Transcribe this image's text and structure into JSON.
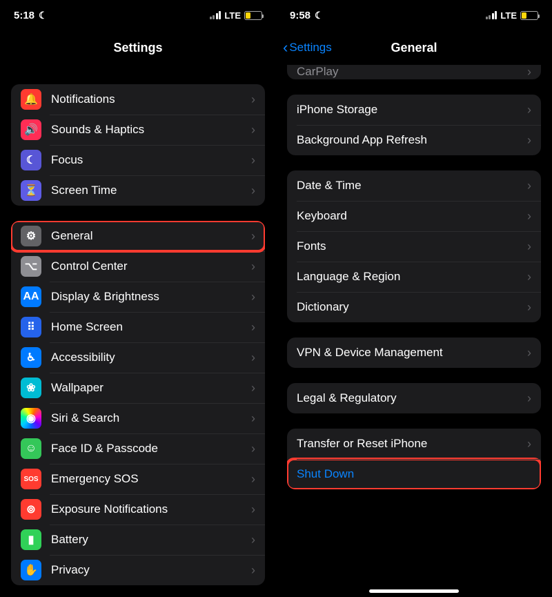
{
  "left": {
    "status": {
      "time": "5:18",
      "network_label": "LTE"
    },
    "title": "Settings",
    "groups": [
      {
        "rows": [
          {
            "id": "notifications",
            "label": "Notifications",
            "icon": "bell-icon",
            "icon_bg": "ic-red",
            "glyph": "🔔"
          },
          {
            "id": "sounds",
            "label": "Sounds & Haptics",
            "icon": "speaker-icon",
            "icon_bg": "ic-pink",
            "glyph": "🔊"
          },
          {
            "id": "focus",
            "label": "Focus",
            "icon": "moon-icon",
            "icon_bg": "ic-indigo",
            "glyph": "☾"
          },
          {
            "id": "screentime",
            "label": "Screen Time",
            "icon": "hourglass-icon",
            "icon_bg": "ic-violet",
            "glyph": "⏳"
          }
        ]
      },
      {
        "rows": [
          {
            "id": "general",
            "label": "General",
            "icon": "gear-icon",
            "icon_bg": "ic-gray",
            "glyph": "⚙",
            "highlight": true
          },
          {
            "id": "controlcenter",
            "label": "Control Center",
            "icon": "switches-icon",
            "icon_bg": "ic-graylight",
            "glyph": "⌥"
          },
          {
            "id": "display",
            "label": "Display & Brightness",
            "icon": "text-size-icon",
            "icon_bg": "ic-blue",
            "glyph": "AA"
          },
          {
            "id": "homescreen",
            "label": "Home Screen",
            "icon": "grid-icon",
            "icon_bg": "ic-homescreen",
            "glyph": "⠿"
          },
          {
            "id": "accessibility",
            "label": "Accessibility",
            "icon": "accessibility-icon",
            "icon_bg": "ic-blue",
            "glyph": "♿︎"
          },
          {
            "id": "wallpaper",
            "label": "Wallpaper",
            "icon": "flower-icon",
            "icon_bg": "ic-teal",
            "glyph": "❀"
          },
          {
            "id": "siri",
            "label": "Siri & Search",
            "icon": "siri-icon",
            "icon_bg": "ic-siri",
            "glyph": "◉"
          },
          {
            "id": "faceid",
            "label": "Face ID & Passcode",
            "icon": "faceid-icon",
            "icon_bg": "ic-green",
            "glyph": "☺"
          },
          {
            "id": "sos",
            "label": "Emergency SOS",
            "icon": "sos-icon",
            "icon_bg": "ic-red",
            "glyph": "SOS"
          },
          {
            "id": "exposure",
            "label": "Exposure Notifications",
            "icon": "exposure-icon",
            "icon_bg": "ic-red",
            "glyph": "⊚"
          },
          {
            "id": "battery",
            "label": "Battery",
            "icon": "battery-icon",
            "icon_bg": "ic-green2",
            "glyph": "▮"
          },
          {
            "id": "privacy",
            "label": "Privacy",
            "icon": "hand-icon",
            "icon_bg": "ic-blue",
            "glyph": "✋"
          }
        ]
      }
    ]
  },
  "right": {
    "status": {
      "time": "9:58",
      "network_label": "LTE"
    },
    "back_label": "Settings",
    "title": "General",
    "groups": [
      {
        "partial_top": true,
        "rows": [
          {
            "id": "carplay",
            "label": "CarPlay"
          }
        ]
      },
      {
        "rows": [
          {
            "id": "storage",
            "label": "iPhone Storage"
          },
          {
            "id": "bgrefresh",
            "label": "Background App Refresh"
          }
        ]
      },
      {
        "rows": [
          {
            "id": "datetime",
            "label": "Date & Time"
          },
          {
            "id": "keyboard",
            "label": "Keyboard"
          },
          {
            "id": "fonts",
            "label": "Fonts"
          },
          {
            "id": "language",
            "label": "Language & Region"
          },
          {
            "id": "dictionary",
            "label": "Dictionary"
          }
        ]
      },
      {
        "rows": [
          {
            "id": "vpn",
            "label": "VPN & Device Management"
          }
        ]
      },
      {
        "rows": [
          {
            "id": "legal",
            "label": "Legal & Regulatory"
          }
        ]
      },
      {
        "rows": [
          {
            "id": "transfer",
            "label": "Transfer or Reset iPhone"
          },
          {
            "id": "shutdown",
            "label": "Shut Down",
            "link": true,
            "highlight": true,
            "no_chevron": true
          }
        ]
      }
    ]
  }
}
